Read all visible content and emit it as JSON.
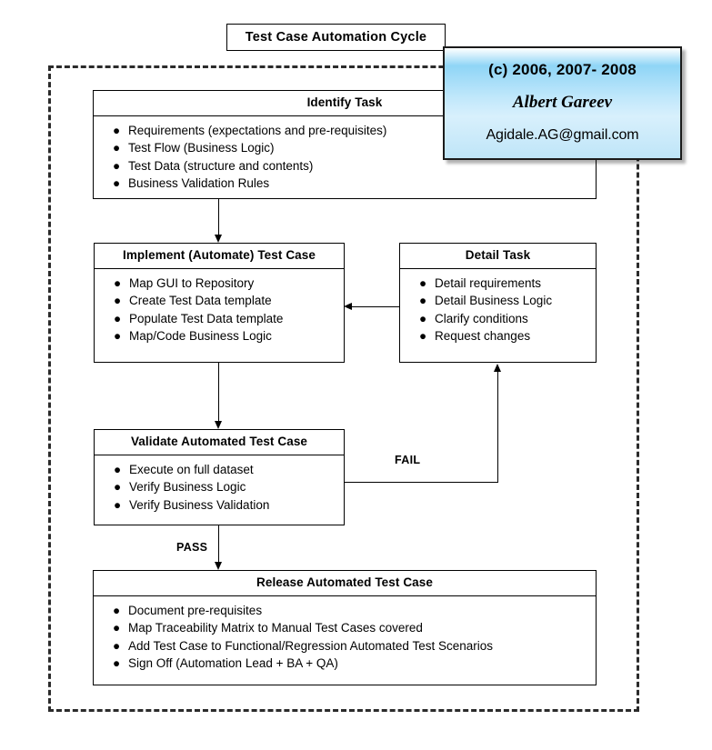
{
  "diagram": {
    "title": "Test Case Automation Cycle",
    "credit": {
      "copyright": "(c) 2006, 2007- 2008",
      "author": "Albert Gareev",
      "email": "Agidale.AG@gmail.com"
    },
    "nodes": [
      {
        "id": "identify-task",
        "title": "Identify Task",
        "items": [
          "Requirements (expectations and pre-requisites)",
          "Test Flow (Business Logic)",
          "Test Data (structure and contents)",
          "Business Validation Rules"
        ]
      },
      {
        "id": "implement-test-case",
        "title": "Implement (Automate) Test Case",
        "items": [
          "Map GUI to Repository",
          "Create Test Data template",
          "Populate Test Data template",
          "Map/Code Business Logic"
        ]
      },
      {
        "id": "detail-task",
        "title": "Detail Task",
        "items": [
          "Detail requirements",
          "Detail Business Logic",
          "Clarify conditions",
          "Request changes"
        ]
      },
      {
        "id": "validate-test-case",
        "title": "Validate Automated Test Case",
        "items": [
          "Execute on full dataset",
          "Verify Business Logic",
          "Verify Business Validation"
        ]
      },
      {
        "id": "release-test-case",
        "title": "Release Automated Test Case",
        "items": [
          "Document pre-requisites",
          "Map Traceability Matrix to Manual Test Cases covered",
          "Add Test Case to Functional/Regression Automated Test Scenarios",
          "Sign Off (Automation Lead + BA + QA)"
        ]
      }
    ],
    "edge_labels": {
      "fail": "FAIL",
      "pass": "PASS"
    },
    "bullet_glyph": "●",
    "colors": {
      "line": "#000000",
      "box_fill": "#ffffff",
      "credit_top": "#8fd5f6",
      "credit_bottom": "#bfe5f8",
      "boundary": "#2b2b2b"
    }
  }
}
